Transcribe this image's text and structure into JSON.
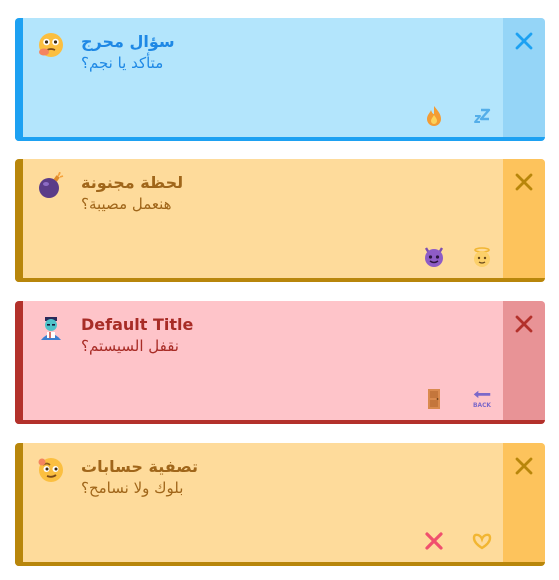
{
  "cards": [
    {
      "title": "سؤال محرج",
      "message": "متأكد يا نجم؟",
      "bg": "#b3e5fc",
      "accent": "#1da1f2",
      "close_bg": "#95d5f7",
      "text_color": "#1e88e5",
      "icon": "thinking-face-icon",
      "actions": [
        "fire-icon",
        "sleeping-zzz-icon"
      ]
    },
    {
      "title": "لحظة مجنونة",
      "message": "هنعمل مصيبة؟",
      "bg": "#fedb9b",
      "accent": "#b8860b",
      "close_bg": "#fdc35c",
      "text_color": "#a0661a",
      "icon": "bomb-icon",
      "actions": [
        "smiling-devil-icon",
        "angel-face-icon"
      ]
    },
    {
      "title": "Default Title",
      "message": "نقفل السيستم؟",
      "bg": "#fec4c9",
      "accent": "#b3312b",
      "close_bg": "#e89396",
      "text_color": "#a82c26",
      "icon": "zombie-icon",
      "actions": [
        "door-icon",
        "back-arrow-icon"
      ]
    },
    {
      "title": "تصفية حسابات",
      "message": "بلوك ولا نسامح؟",
      "bg": "#fedb9b",
      "accent": "#b8860b",
      "close_bg": "#fdc35c",
      "text_color": "#a0661a",
      "icon": "smirking-face-icon",
      "actions": [
        "cross-mark-icon",
        "heart-hands-icon"
      ]
    }
  ]
}
